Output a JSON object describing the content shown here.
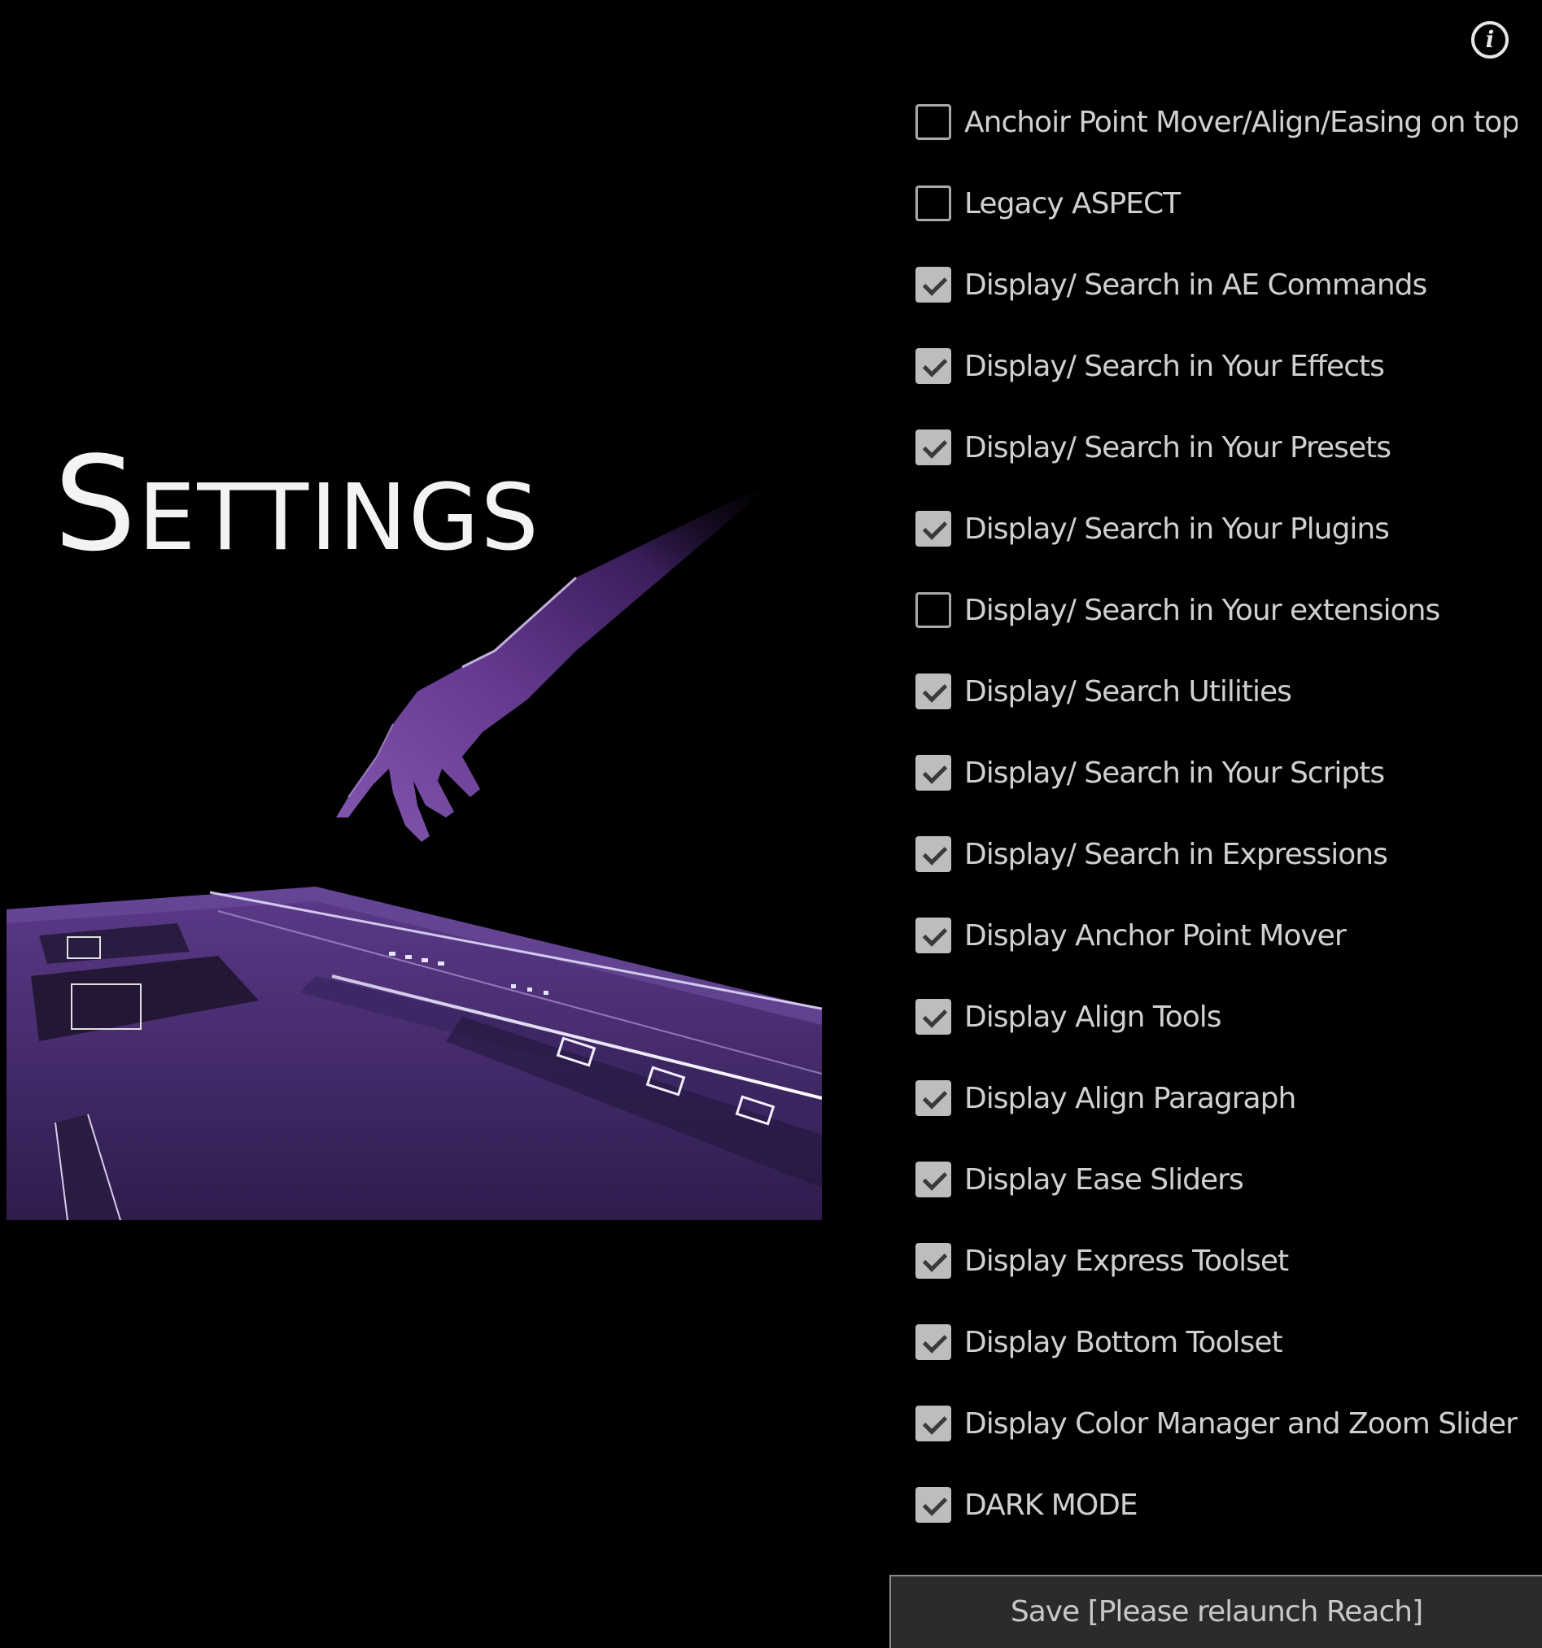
{
  "header": {
    "info_icon": "info-icon",
    "title": "Settings"
  },
  "colors": {
    "background": "#000000",
    "accent_purple": "#5a2d82",
    "checkbox_checked": "#bdbdbd",
    "text": "#d0d0d0"
  },
  "options": [
    {
      "label": "Anchoir Point Mover/Align/Easing on top",
      "checked": false
    },
    {
      "label": "Legacy ASPECT",
      "checked": false
    },
    {
      "label": "Display/ Search in AE Commands",
      "checked": true
    },
    {
      "label": "Display/ Search in Your Effects",
      "checked": true
    },
    {
      "label": "Display/ Search in Your Presets",
      "checked": true
    },
    {
      "label": "Display/ Search in Your Plugins",
      "checked": true
    },
    {
      "label": "Display/ Search in Your extensions",
      "checked": false
    },
    {
      "label": "Display/ Search Utilities",
      "checked": true
    },
    {
      "label": "Display/ Search in Your Scripts",
      "checked": true
    },
    {
      "label": "Display/ Search in Expressions",
      "checked": true
    },
    {
      "label": "Display Anchor Point Mover",
      "checked": true
    },
    {
      "label": "Display Align Tools",
      "checked": true
    },
    {
      "label": "Display Align Paragraph",
      "checked": true
    },
    {
      "label": "Display Ease Sliders",
      "checked": true
    },
    {
      "label": "Display Express Toolset",
      "checked": true
    },
    {
      "label": "Display Bottom Toolset",
      "checked": true
    },
    {
      "label": "Display Color Manager and Zoom Slider",
      "checked": true
    },
    {
      "label": "DARK MODE",
      "checked": true
    }
  ],
  "footer": {
    "save_label": "Save [Please relaunch Reach]"
  }
}
